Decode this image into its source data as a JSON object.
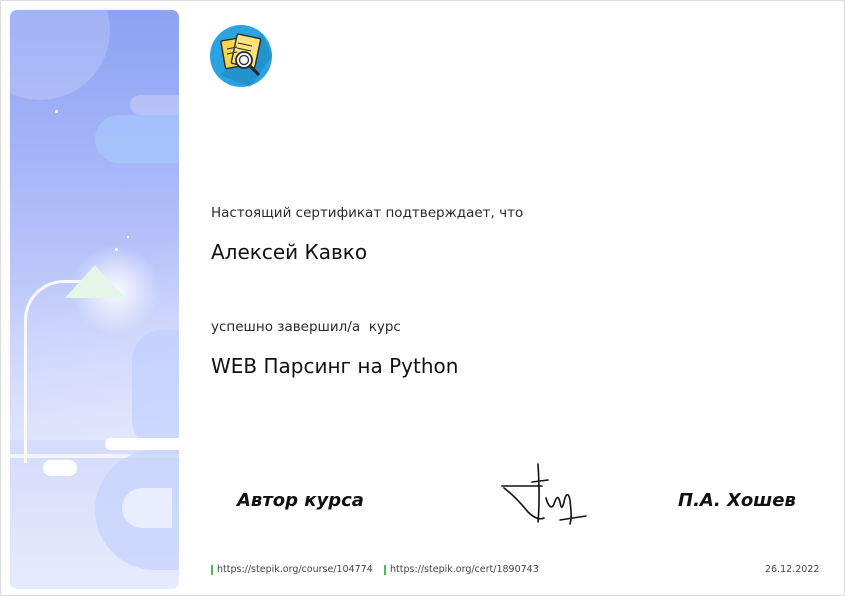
{
  "certificate": {
    "intro_text": "Настоящий сертификат подтверждает, что",
    "recipient_name": "Алексей Кавко",
    "completed_text": "успешно завершил/а  курс",
    "course_title": "WEB Парсинг на Python"
  },
  "signature_block": {
    "author_label": "Автор курса",
    "author_name": "П.А. Хошев"
  },
  "footer": {
    "course_link": "https://stepik.org/course/104774",
    "cert_link": "https://stepik.org/cert/1890743",
    "date": "26.12.2022"
  },
  "logo": {
    "icon": "documents-magnifier-icon",
    "bg_color": "#2aa3e0"
  },
  "colors": {
    "panel_top": "#8da2f4",
    "panel_bottom": "#e6ebfd",
    "link_marker": "#4bbf4b"
  }
}
